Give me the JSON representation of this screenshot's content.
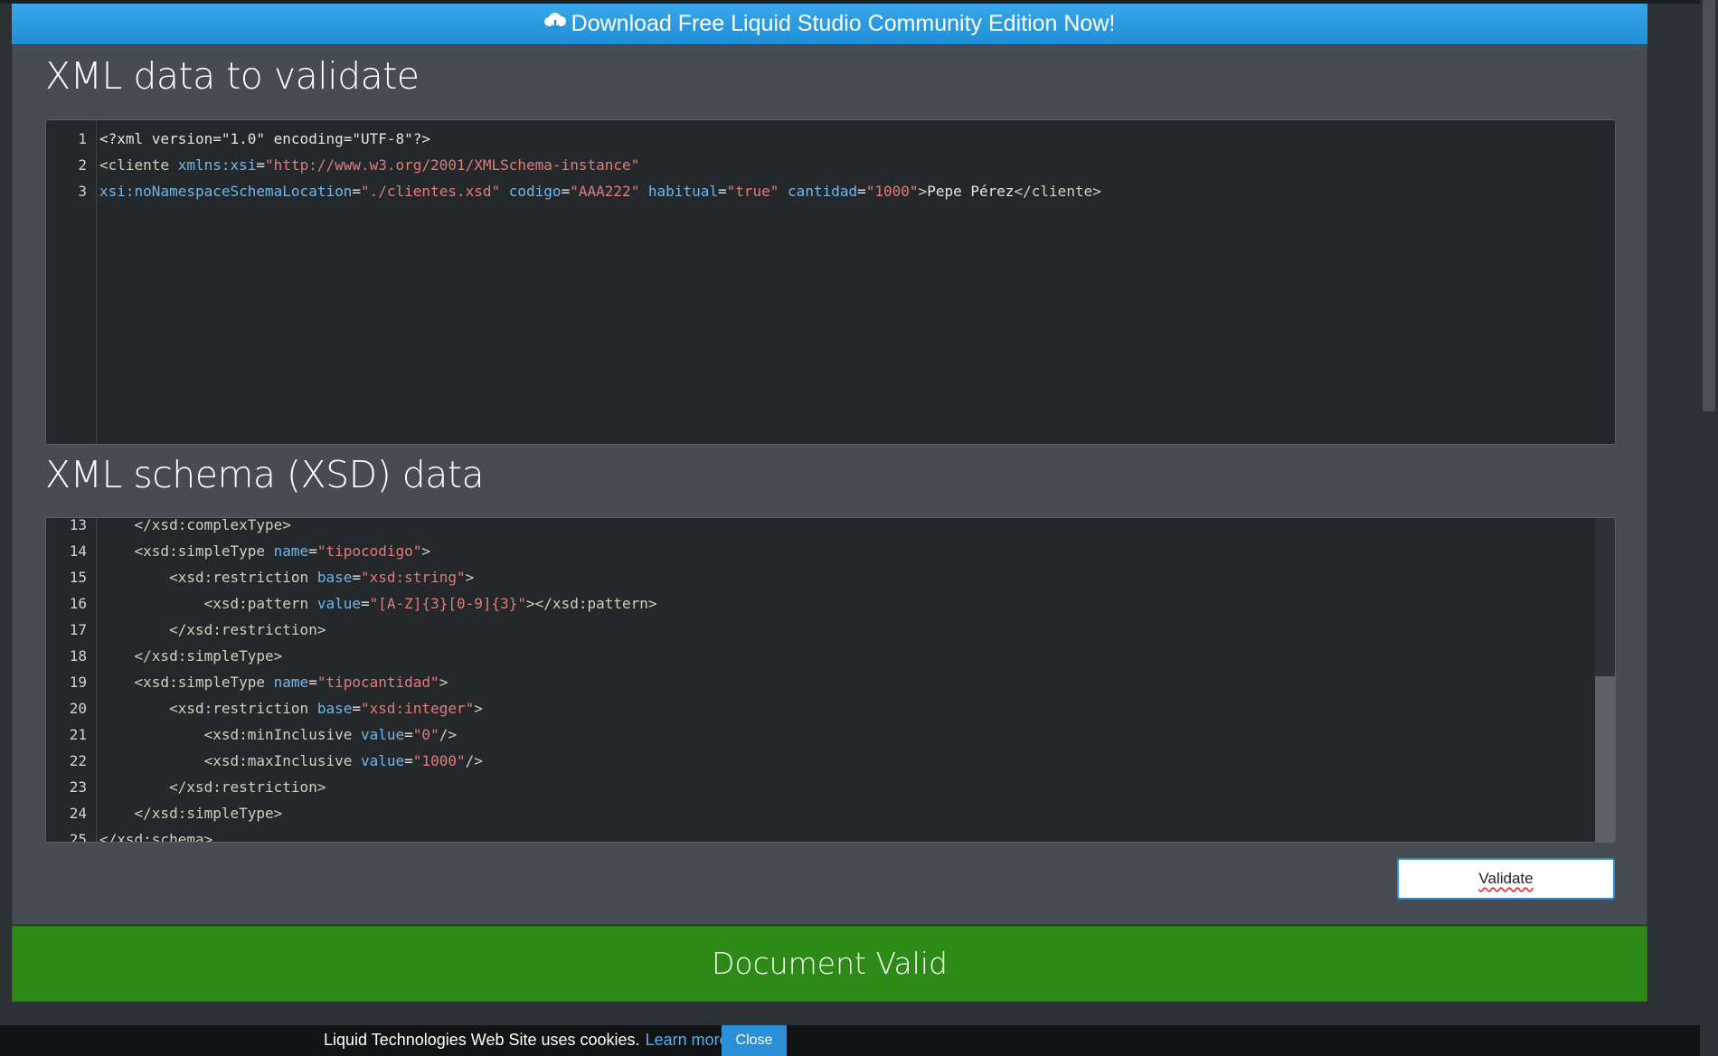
{
  "banner": {
    "text": "Download Free Liquid Studio Community Edition Now!",
    "icon": "cloud-download-icon"
  },
  "xml_section": {
    "title": "XML data to validate",
    "lines": [
      {
        "n": "1",
        "tokens": [
          [
            "t-plain",
            "<?xml version=\"1.0\" encoding=\"UTF-8\"?>"
          ]
        ]
      },
      {
        "n": "2",
        "tokens": [
          [
            "t-tag",
            "<cliente "
          ],
          [
            "t-attr",
            "xmlns:xsi"
          ],
          [
            "t-plain",
            "="
          ],
          [
            "t-str",
            "\"http://www.w3.org/2001/XMLSchema-instance\""
          ]
        ]
      },
      {
        "n": "3",
        "tokens": [
          [
            "t-attr",
            "xsi:noNamespaceSchemaLocation"
          ],
          [
            "t-plain",
            "="
          ],
          [
            "t-str",
            "\"./clientes.xsd\""
          ],
          [
            "t-plain",
            " "
          ],
          [
            "t-attr",
            "codigo"
          ],
          [
            "t-plain",
            "="
          ],
          [
            "t-str",
            "\"AAA222\""
          ],
          [
            "t-plain",
            " "
          ],
          [
            "t-attr",
            "habitual"
          ],
          [
            "t-plain",
            "="
          ],
          [
            "t-str",
            "\"true\""
          ],
          [
            "t-plain",
            " "
          ],
          [
            "t-attr",
            "cantidad"
          ],
          [
            "t-plain",
            "="
          ],
          [
            "t-str",
            "\"1000\""
          ],
          [
            "t-tag",
            ">"
          ],
          [
            "t-plain",
            "Pepe Pérez"
          ],
          [
            "t-tag",
            "</cliente>"
          ]
        ]
      }
    ]
  },
  "xsd_section": {
    "title": "XML schema (XSD) data",
    "lines": [
      {
        "n": "13",
        "tokens": [
          [
            "t-tag",
            "    </xsd:complexType>"
          ]
        ]
      },
      {
        "n": "14",
        "tokens": [
          [
            "t-tag",
            "    <xsd:simpleType "
          ],
          [
            "t-attr",
            "name"
          ],
          [
            "t-plain",
            "="
          ],
          [
            "t-str",
            "\"tipocodigo\""
          ],
          [
            "t-tag",
            ">"
          ]
        ]
      },
      {
        "n": "15",
        "tokens": [
          [
            "t-tag",
            "        <xsd:restriction "
          ],
          [
            "t-attr",
            "base"
          ],
          [
            "t-plain",
            "="
          ],
          [
            "t-str",
            "\"xsd:string\""
          ],
          [
            "t-tag",
            ">"
          ]
        ]
      },
      {
        "n": "16",
        "tokens": [
          [
            "t-tag",
            "            <xsd:pattern "
          ],
          [
            "t-attr",
            "value"
          ],
          [
            "t-plain",
            "="
          ],
          [
            "t-str",
            "\"[A-Z]{3}[0-9]{3}\""
          ],
          [
            "t-tag",
            "></xsd:pattern>"
          ]
        ]
      },
      {
        "n": "17",
        "tokens": [
          [
            "t-tag",
            "        </xsd:restriction>"
          ]
        ]
      },
      {
        "n": "18",
        "tokens": [
          [
            "t-tag",
            "    </xsd:simpleType>"
          ]
        ]
      },
      {
        "n": "19",
        "tokens": [
          [
            "t-tag",
            "    <xsd:simpleType "
          ],
          [
            "t-attr",
            "name"
          ],
          [
            "t-plain",
            "="
          ],
          [
            "t-str",
            "\"tipocantidad\""
          ],
          [
            "t-tag",
            ">"
          ]
        ]
      },
      {
        "n": "20",
        "tokens": [
          [
            "t-tag",
            "        <xsd:restriction "
          ],
          [
            "t-attr",
            "base"
          ],
          [
            "t-plain",
            "="
          ],
          [
            "t-str",
            "\"xsd:integer\""
          ],
          [
            "t-tag",
            ">"
          ]
        ]
      },
      {
        "n": "21",
        "tokens": [
          [
            "t-tag",
            "            <xsd:minInclusive "
          ],
          [
            "t-attr",
            "value"
          ],
          [
            "t-plain",
            "="
          ],
          [
            "t-str",
            "\"0\""
          ],
          [
            "t-tag",
            "/>"
          ]
        ]
      },
      {
        "n": "22",
        "tokens": [
          [
            "t-tag",
            "            <xsd:maxInclusive "
          ],
          [
            "t-attr",
            "value"
          ],
          [
            "t-plain",
            "="
          ],
          [
            "t-str",
            "\"1000\""
          ],
          [
            "t-tag",
            "/>"
          ]
        ]
      },
      {
        "n": "23",
        "tokens": [
          [
            "t-tag",
            "        </xsd:restriction>"
          ]
        ]
      },
      {
        "n": "24",
        "tokens": [
          [
            "t-tag",
            "    </xsd:simpleType>"
          ]
        ]
      },
      {
        "n": "25",
        "tokens": [
          [
            "t-tag",
            "</xsd:schema>"
          ]
        ]
      }
    ]
  },
  "validate_button": {
    "label": "Validate"
  },
  "result": {
    "text": "Document Valid",
    "color": "#2e8a17"
  },
  "cookie": {
    "text": "Liquid Technologies Web Site uses cookies.",
    "link": "Learn more.",
    "close": "Close"
  }
}
